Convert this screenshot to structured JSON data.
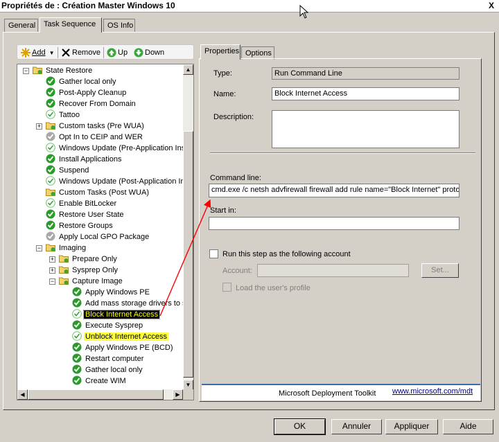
{
  "window": {
    "title": "Propriétés de : Création Master Windows 10",
    "close_glyph": "X"
  },
  "outer_tabs": [
    {
      "label": "General"
    },
    {
      "label": "Task Sequence"
    },
    {
      "label": "OS Info"
    }
  ],
  "toolbar": {
    "add": "Add",
    "remove": "Remove",
    "up": "Up",
    "down": "Down"
  },
  "tree": {
    "items": [
      {
        "label": "State Restore",
        "icon": "folder-icon",
        "level": 0,
        "expander": "-"
      },
      {
        "label": "Gather local only",
        "icon": "check-icon",
        "level": 1
      },
      {
        "label": "Post-Apply Cleanup",
        "icon": "check-icon",
        "level": 1
      },
      {
        "label": "Recover From Domain",
        "icon": "check-icon",
        "level": 1
      },
      {
        "label": "Tattoo",
        "icon": "check-light-icon",
        "level": 1
      },
      {
        "label": "Custom tasks (Pre WUA)",
        "icon": "folder-icon",
        "level": 1,
        "expander": "+"
      },
      {
        "label": "Opt In to CEIP and WER",
        "icon": "gray-icon",
        "level": 1
      },
      {
        "label": "Windows Update (Pre-Application Inst",
        "icon": "check-light-icon",
        "level": 1
      },
      {
        "label": "Install Applications",
        "icon": "check-icon",
        "level": 1
      },
      {
        "label": "Suspend",
        "icon": "check-icon",
        "level": 1
      },
      {
        "label": "Windows Update (Post-Application Ins",
        "icon": "check-light-icon",
        "level": 1
      },
      {
        "label": "Custom Tasks (Post WUA)",
        "icon": "folder-icon",
        "level": 1
      },
      {
        "label": "Enable BitLocker",
        "icon": "check-light-icon",
        "level": 1
      },
      {
        "label": "Restore User State",
        "icon": "check-icon",
        "level": 1
      },
      {
        "label": "Restore Groups",
        "icon": "check-icon",
        "level": 1
      },
      {
        "label": "Apply Local GPO Package",
        "icon": "gray-icon",
        "level": 1
      },
      {
        "label": "Imaging",
        "icon": "folder-icon",
        "level": 1,
        "expander": "-"
      },
      {
        "label": "Prepare Only",
        "icon": "folder-icon",
        "level": 2,
        "expander": "+"
      },
      {
        "label": "Sysprep Only",
        "icon": "folder-icon",
        "level": 2,
        "expander": "+"
      },
      {
        "label": "Capture Image",
        "icon": "folder-icon",
        "level": 2,
        "expander": "-"
      },
      {
        "label": "Apply Windows PE",
        "icon": "check-icon",
        "level": 3
      },
      {
        "label": "Add mass storage drivers to sy",
        "icon": "check-icon",
        "level": 3
      },
      {
        "label": "Block Internet Access",
        "icon": "check-light-icon",
        "level": 3,
        "state": "selected"
      },
      {
        "label": "Execute Sysprep",
        "icon": "check-icon",
        "level": 3
      },
      {
        "label": "Unblock Internet Access",
        "icon": "check-light-icon",
        "level": 3,
        "state": "highlight"
      },
      {
        "label": "Apply Windows PE (BCD)",
        "icon": "check-icon",
        "level": 3
      },
      {
        "label": "Restart computer",
        "icon": "check-icon",
        "level": 3
      },
      {
        "label": "Gather local only",
        "icon": "check-icon",
        "level": 3
      },
      {
        "label": "Create WIM",
        "icon": "check-icon",
        "level": 3
      }
    ]
  },
  "inner_tabs": [
    {
      "label": "Properties"
    },
    {
      "label": "Options"
    }
  ],
  "properties": {
    "type_label": "Type:",
    "type_value": "Run Command Line",
    "name_label": "Name:",
    "name_value": "Block Internet Access",
    "description_label": "Description:",
    "description_value": "",
    "command_label": "Command line:",
    "command_value": "cmd.exe /c netsh advfirewall firewall add rule name=\"Block Internet\" proto=",
    "startin_label": "Start in:",
    "startin_value": "",
    "run_as_label": "Run this step as the following account",
    "account_label": "Account:",
    "account_value": "",
    "set_button": "Set...",
    "load_profile_label": "Load the user's profile"
  },
  "footer": {
    "mdt_text": "Microsoft Deployment Toolkit",
    "mdt_link": "www.microsoft.com/mdt"
  },
  "buttons": {
    "ok": "OK",
    "cancel": "Annuler",
    "apply": "Appliquer",
    "help": "Aide"
  },
  "colors": {
    "selection_bg": "#000000",
    "selection_fg": "#ffff00",
    "highlight": "#ffff40",
    "annotation_arrow": "#ff0000",
    "check_green": "#2a9a2a"
  }
}
